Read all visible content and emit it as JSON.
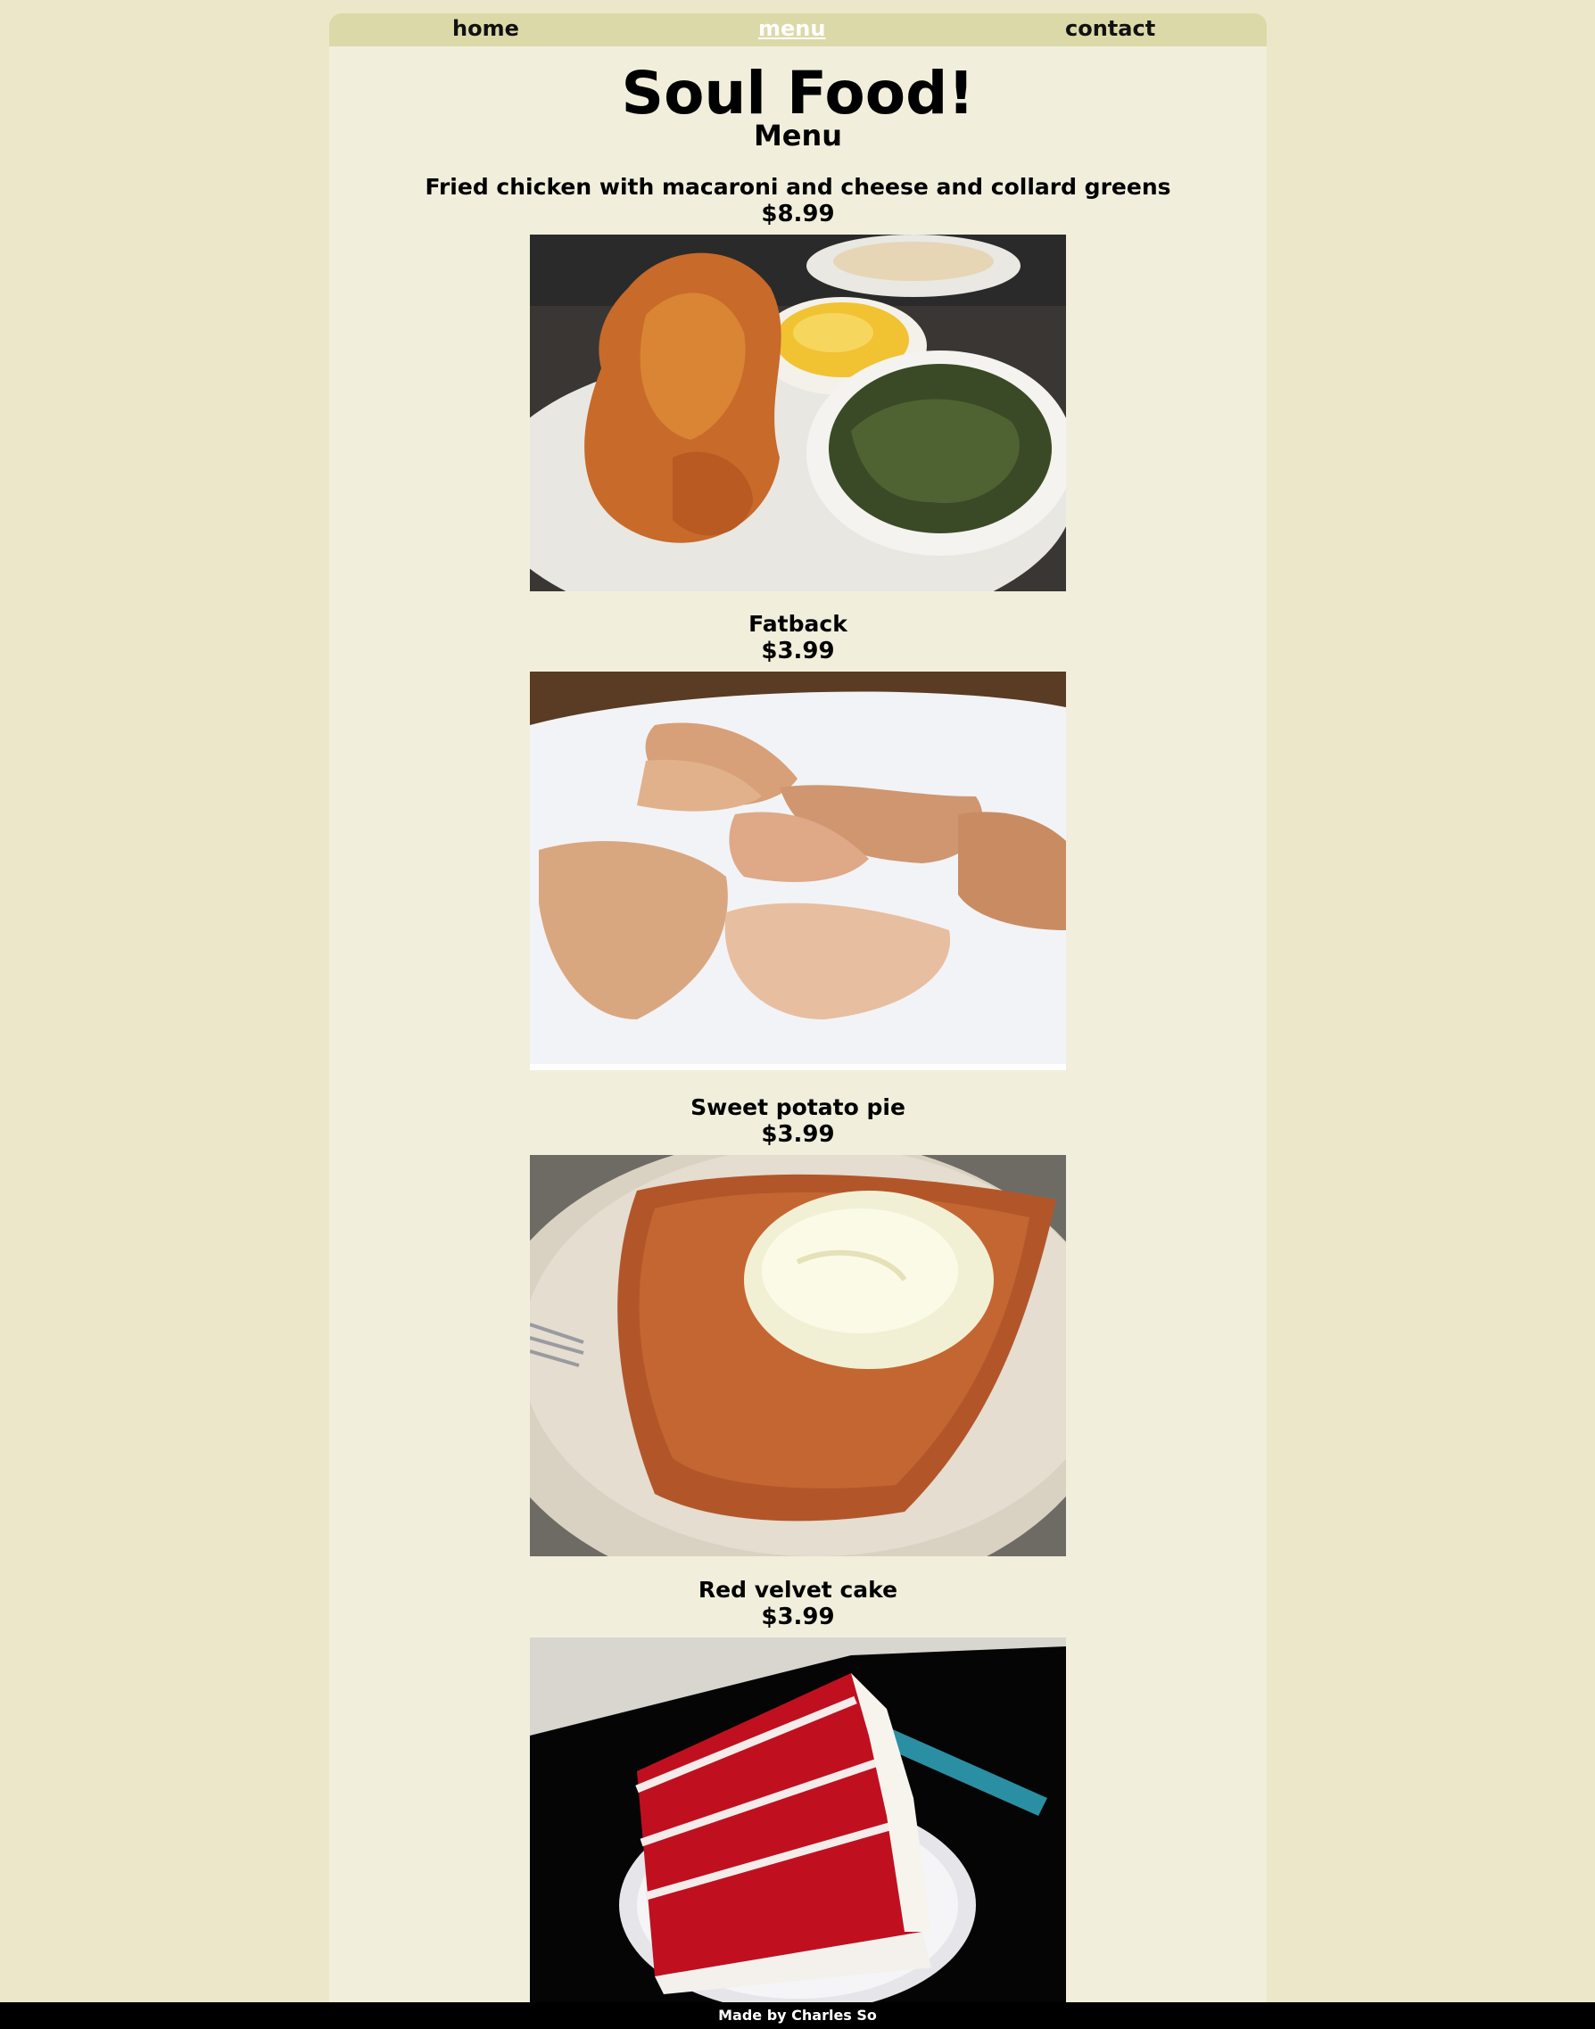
{
  "nav": {
    "home": "home",
    "menu": "menu",
    "contact": "contact"
  },
  "header": {
    "title": "Soul Food!",
    "subtitle": "Menu"
  },
  "items": [
    {
      "name": "Fried chicken with macaroni and cheese and collard greens",
      "price": "$8.99"
    },
    {
      "name": "Fatback",
      "price": "$3.99"
    },
    {
      "name": "Sweet potato pie",
      "price": "$3.99"
    },
    {
      "name": "Red velvet cake",
      "price": "$3.99"
    }
  ],
  "footer": {
    "credit": "Made by Charles So"
  },
  "colors": {
    "background": "#ebe7c8",
    "panel": "#f1efdb",
    "nav": "#dcd9a8",
    "footer": "#000000"
  }
}
